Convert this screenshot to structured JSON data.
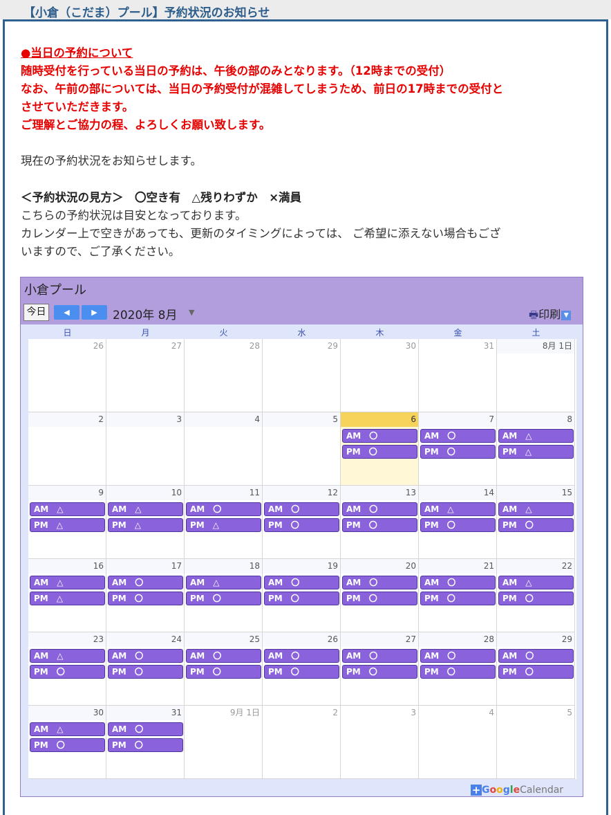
{
  "header": {
    "title": "【小倉（こだま）プール】予約状況のお知らせ"
  },
  "notice": {
    "heading": "●当日の予約について",
    "line1": "随時受付を行っている当日の予約は、午後の部のみとなります。（12時までの受付）",
    "line2": "なお、午前の部については、当日の予約受付が混雑してしまうため、前日の17時までの受付と",
    "line3": "させていただきます。",
    "line4": "ご理解とご協力の程、よろしくお願い致します。"
  },
  "intro": "現在の予約状況をお知らせします。",
  "legend": {
    "title": "＜予約状況の見方＞　〇空き有　△残りわずか　×満員",
    "line1": "こちらの予約状況は目安となっております。",
    "line2": "カレンダー上で空きがあっても、更新のタイミングによっては、 ご希望に添えない場合もござ",
    "line3": "いますので、ご了承ください。"
  },
  "calendar": {
    "title": "小倉プール",
    "today_label": "今日",
    "prev_icon": "◀",
    "next_icon": "▶",
    "month_label": "2020年 8月",
    "print_label": "印刷",
    "weekdays": [
      "日",
      "月",
      "火",
      "水",
      "木",
      "金",
      "土"
    ],
    "footer": {
      "google": [
        "G",
        "o",
        "o",
        "g",
        "l",
        "e"
      ],
      "calendar": "Calendar"
    },
    "today_date": "6",
    "weeks": [
      [
        {
          "label": "26",
          "other": true,
          "events": []
        },
        {
          "label": "27",
          "other": true,
          "events": []
        },
        {
          "label": "28",
          "other": true,
          "events": []
        },
        {
          "label": "29",
          "other": true,
          "events": []
        },
        {
          "label": "30",
          "other": true,
          "events": []
        },
        {
          "label": "31",
          "other": true,
          "events": []
        },
        {
          "label": "8月 1日",
          "other": false,
          "events": []
        }
      ],
      [
        {
          "label": "2",
          "other": false,
          "events": []
        },
        {
          "label": "3",
          "other": false,
          "events": []
        },
        {
          "label": "4",
          "other": false,
          "events": []
        },
        {
          "label": "5",
          "other": false,
          "events": []
        },
        {
          "label": "6",
          "other": false,
          "today": true,
          "events": [
            "AM　〇",
            "PM　〇"
          ]
        },
        {
          "label": "7",
          "other": false,
          "events": [
            "AM　〇",
            "PM　〇"
          ]
        },
        {
          "label": "8",
          "other": false,
          "events": [
            "AM　△",
            "PM　△"
          ]
        }
      ],
      [
        {
          "label": "9",
          "other": false,
          "events": [
            "AM　△",
            "PM　△"
          ]
        },
        {
          "label": "10",
          "other": false,
          "events": [
            "AM　△",
            "PM　△"
          ]
        },
        {
          "label": "11",
          "other": false,
          "events": [
            "AM　〇",
            "PM　△"
          ]
        },
        {
          "label": "12",
          "other": false,
          "events": [
            "AM　〇",
            "PM　〇"
          ]
        },
        {
          "label": "13",
          "other": false,
          "events": [
            "AM　〇",
            "PM　〇"
          ]
        },
        {
          "label": "14",
          "other": false,
          "events": [
            "AM　△",
            "PM　〇"
          ]
        },
        {
          "label": "15",
          "other": false,
          "events": [
            "AM　△",
            "PM　〇"
          ]
        }
      ],
      [
        {
          "label": "16",
          "other": false,
          "events": [
            "AM　△",
            "PM　△"
          ]
        },
        {
          "label": "17",
          "other": false,
          "events": [
            "AM　〇",
            "PM　〇"
          ]
        },
        {
          "label": "18",
          "other": false,
          "events": [
            "AM　△",
            "PM　〇"
          ]
        },
        {
          "label": "19",
          "other": false,
          "events": [
            "AM　〇",
            "PM　〇"
          ]
        },
        {
          "label": "20",
          "other": false,
          "events": [
            "AM　〇",
            "PM　〇"
          ]
        },
        {
          "label": "21",
          "other": false,
          "events": [
            "AM　〇",
            "PM　〇"
          ]
        },
        {
          "label": "22",
          "other": false,
          "events": [
            "AM　△",
            "PM　〇"
          ]
        }
      ],
      [
        {
          "label": "23",
          "other": false,
          "events": [
            "AM　△",
            "PM　〇"
          ]
        },
        {
          "label": "24",
          "other": false,
          "events": [
            "AM　〇",
            "PM　〇"
          ]
        },
        {
          "label": "25",
          "other": false,
          "events": [
            "AM　〇",
            "PM　〇"
          ]
        },
        {
          "label": "26",
          "other": false,
          "events": [
            "AM　〇",
            "PM　〇"
          ]
        },
        {
          "label": "27",
          "other": false,
          "events": [
            "AM　〇",
            "PM　〇"
          ]
        },
        {
          "label": "28",
          "other": false,
          "events": [
            "AM　〇",
            "PM　〇"
          ]
        },
        {
          "label": "29",
          "other": false,
          "events": [
            "AM　〇",
            "PM　〇"
          ]
        }
      ],
      [
        {
          "label": "30",
          "other": false,
          "events": [
            "AM　△",
            "PM　〇"
          ]
        },
        {
          "label": "31",
          "other": false,
          "events": [
            "AM　〇",
            "PM　〇"
          ]
        },
        {
          "label": "9月 1日",
          "other": true,
          "events": []
        },
        {
          "label": "2",
          "other": true,
          "events": []
        },
        {
          "label": "3",
          "other": true,
          "events": []
        },
        {
          "label": "4",
          "other": true,
          "events": []
        },
        {
          "label": "5",
          "other": true,
          "events": []
        }
      ]
    ]
  }
}
